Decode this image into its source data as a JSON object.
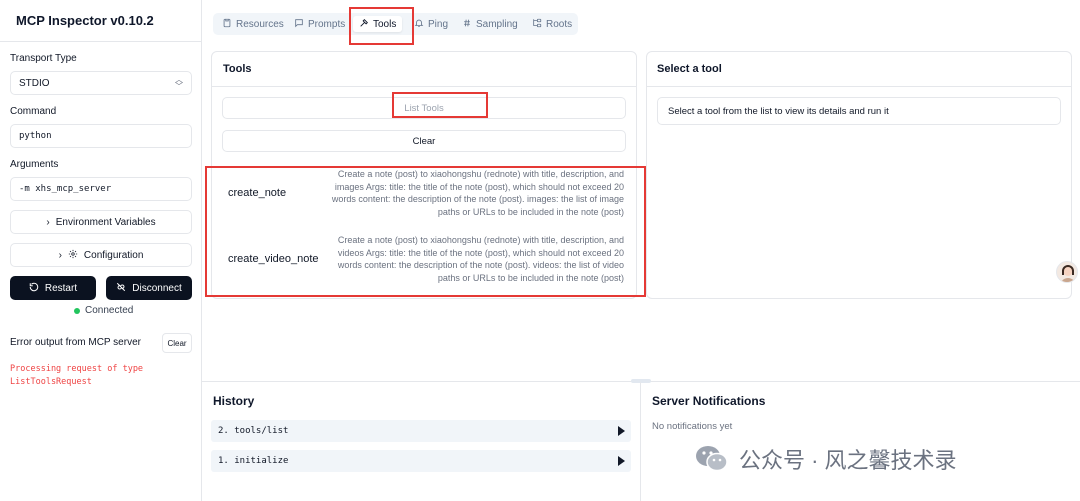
{
  "app": {
    "title": "MCP Inspector v0.10.2"
  },
  "sidebar": {
    "transport_label": "Transport Type",
    "transport_value": "STDIO",
    "command_label": "Command",
    "command_value": "python",
    "arguments_label": "Arguments",
    "arguments_value": "-m xhs_mcp_server",
    "env_button": "Environment Variables",
    "config_button": "Configuration",
    "restart_button": "Restart",
    "disconnect_button": "Disconnect",
    "status": "Connected",
    "error_label": "Error output from MCP server",
    "error_clear": "Clear",
    "error_text": "Processing request of type ListToolsRequest"
  },
  "tabs": [
    {
      "label": "Resources",
      "icon": "file-icon"
    },
    {
      "label": "Prompts",
      "icon": "message-icon"
    },
    {
      "label": "Tools",
      "icon": "hammer-icon",
      "active": true
    },
    {
      "label": "Ping",
      "icon": "bell-icon"
    },
    {
      "label": "Sampling",
      "icon": "hash-icon"
    },
    {
      "label": "Roots",
      "icon": "folder-tree-icon"
    }
  ],
  "tools_panel": {
    "title": "Tools",
    "list_button": "List Tools",
    "clear_button": "Clear",
    "tools": [
      {
        "name": "create_note",
        "description": "Create a note (post) to xiaohongshu (rednote) with title, description, and images Args: title: the title of the note (post), which should not exceed 20 words content: the description of the note (post). images: the list of image paths or URLs to be included in the note (post)"
      },
      {
        "name": "create_video_note",
        "description": "Create a note (post) to xiaohongshu (rednote) with title, description, and videos Args: title: the title of the note (post), which should not exceed 20 words content: the description of the note (post). videos: the list of video paths or URLs to be included in the note (post)"
      }
    ]
  },
  "detail_panel": {
    "title": "Select a tool",
    "placeholder": "Select a tool from the list to view its details and run it"
  },
  "history": {
    "title": "History",
    "items": [
      "2. tools/list",
      "1. initialize"
    ]
  },
  "notifications": {
    "title": "Server Notifications",
    "empty": "No notifications yet"
  },
  "watermark": {
    "text": "公众号 · 风之馨技术录"
  },
  "colors": {
    "accent": "#0b1220",
    "error": "#ef4444",
    "connected": "#22c55e",
    "annotation": "#e53935"
  }
}
